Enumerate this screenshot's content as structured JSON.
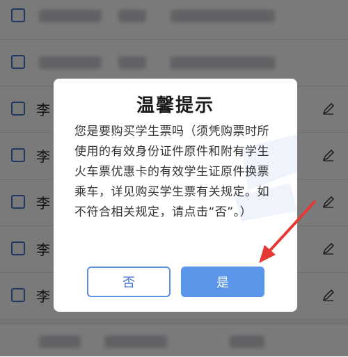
{
  "background_list": {
    "rows": [
      {
        "surname": ""
      },
      {
        "surname": ""
      },
      {
        "surname": "李"
      },
      {
        "surname": "李"
      },
      {
        "surname": "李"
      },
      {
        "surname": "李"
      },
      {
        "surname": "李"
      }
    ]
  },
  "dialog": {
    "title": "温馨提示",
    "message": "您是要购买学生票吗（须凭购票时所使用的有效身份证件原件和附有学生火车票优惠卡的有效学生证原件换票乘车，详见购买学生票有关规定。如不符合相关规定，请点击“否”。）",
    "no_button": "否",
    "yes_button": "是"
  },
  "colors": {
    "accent": "#5b95ea",
    "annotation_arrow": "#e53935"
  }
}
